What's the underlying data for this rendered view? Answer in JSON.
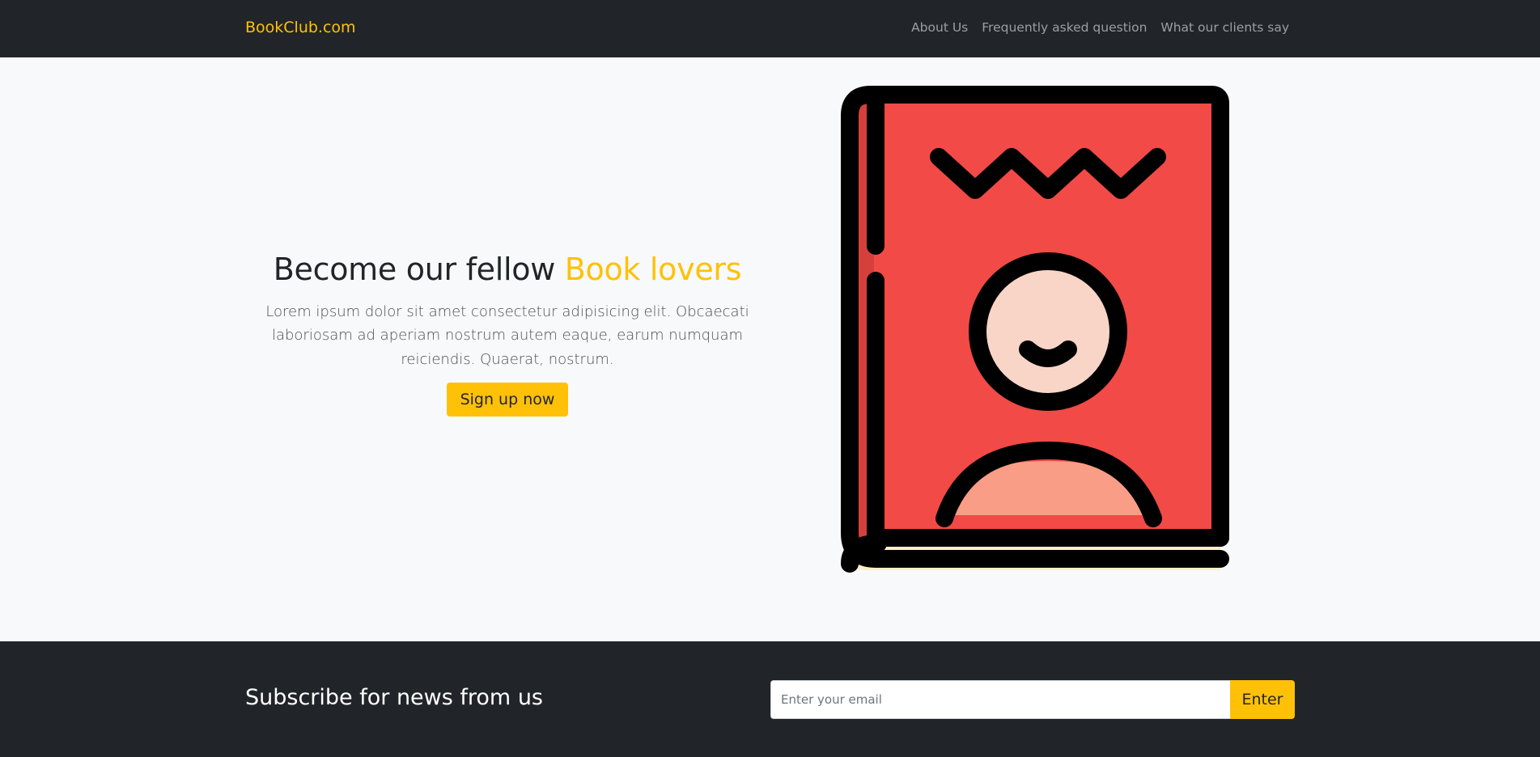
{
  "navbar": {
    "brand": "BookClub.com",
    "links": [
      "About Us",
      "Frequently asked question",
      "What our clients say"
    ]
  },
  "hero": {
    "title_part1": "Become our fellow ",
    "title_accent": "Book lovers",
    "lead": "Lorem ipsum dolor sit amet consectetur adipisicing elit. Obcaecati laboriosam ad aperiam nostrum autem eaque, earum numquam reiciendis. Quaerat, nostrum.",
    "cta_label": "Sign up now",
    "illustration": "book-person-icon"
  },
  "subscribe": {
    "title": "Subscribe for news from us",
    "email_placeholder": "Enter your email",
    "email_value": "",
    "button_label": "Enter"
  },
  "colors": {
    "dark": "#212529",
    "accent": "#ffc107",
    "light_bg": "#f8f9fa",
    "book_cover": "#f24a46",
    "book_spine": "#d6403c",
    "book_pages": "#ffefc9",
    "face": "#f9d5c7",
    "shoulders": "#f99d86"
  }
}
